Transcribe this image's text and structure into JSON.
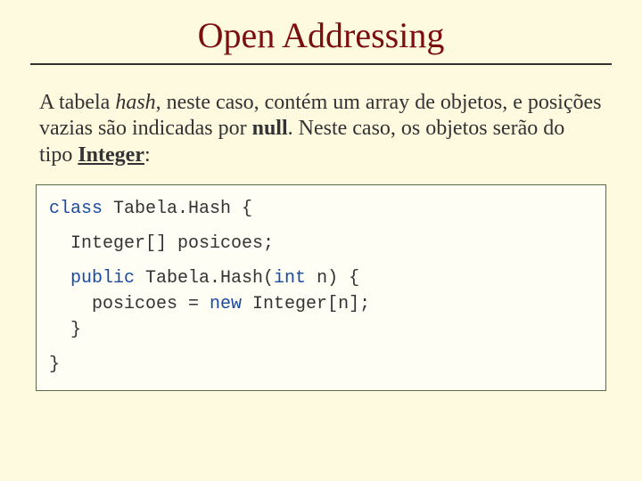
{
  "title": "Open Addressing",
  "paragraph": {
    "p1": "A tabela ",
    "hash": "hash",
    "p2": ", neste caso, contém um array de objetos, e posições vazias são indicadas por ",
    "null": "null",
    "p3": ". Neste caso, os objetos serão do tipo ",
    "integer": "Integer",
    "p4": ":"
  },
  "code": {
    "l1a": "class",
    "l1b": " Tabela.Hash {",
    "l2a": "  Integer[] posicoes;",
    "l3a": "  public",
    "l3b": " Tabela.Hash(",
    "l3c": "int",
    "l3d": " n) {",
    "l4a": "    posicoes = ",
    "l4b": "new",
    "l4c": " Integer[n];",
    "l5": "  }",
    "l6": "}"
  }
}
